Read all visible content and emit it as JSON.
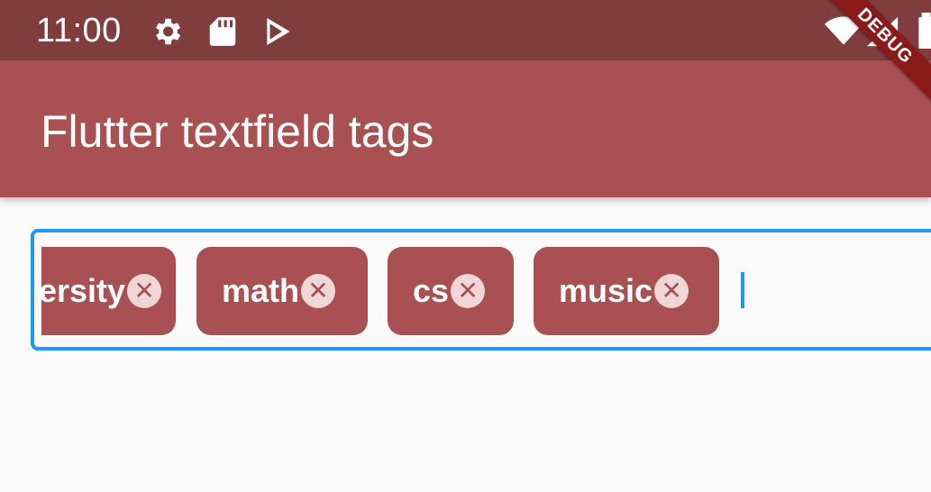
{
  "status_bar": {
    "time": "11:00",
    "icons": [
      "gear-icon",
      "sd-card-icon",
      "play-store-icon",
      "wifi-icon",
      "signal-icon",
      "battery-icon"
    ],
    "color": "#7f3d3e"
  },
  "app_bar": {
    "title": "Flutter textfield tags",
    "color": "#a95152"
  },
  "debug_banner": {
    "label": "DEBUG"
  },
  "tag_field": {
    "border_color": "#2196f3",
    "tags": [
      {
        "label": "university",
        "remove_icon": "close-circle-icon"
      },
      {
        "label": "math",
        "remove_icon": "close-circle-icon"
      },
      {
        "label": "cs",
        "remove_icon": "close-circle-icon"
      },
      {
        "label": "music",
        "remove_icon": "close-circle-icon"
      }
    ],
    "remove_glyph": "✕",
    "input_value": ""
  }
}
